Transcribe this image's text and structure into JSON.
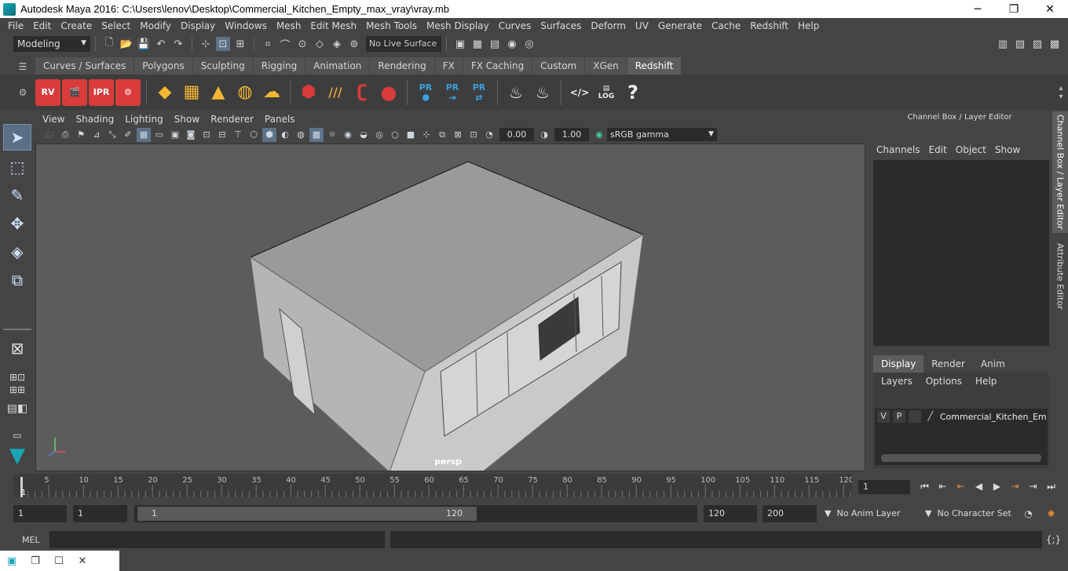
{
  "window": {
    "title": "Autodesk Maya 2016: C:\\Users\\lenov\\Desktop\\Commercial_Kitchen_Empty_max_vray\\vray.mb",
    "minimize": "─",
    "maximize": "❐",
    "close": "✕"
  },
  "menubar": [
    "File",
    "Edit",
    "Create",
    "Select",
    "Modify",
    "Display",
    "Windows",
    "Mesh",
    "Edit Mesh",
    "Mesh Tools",
    "Mesh Display",
    "Curves",
    "Surfaces",
    "Deform",
    "UV",
    "Generate",
    "Cache",
    "Redshift",
    "Help"
  ],
  "statusline": {
    "mode": "Modeling",
    "live_surface": "No Live Surface"
  },
  "shelf_tabs": [
    "Curves / Surfaces",
    "Polygons",
    "Sculpting",
    "Rigging",
    "Animation",
    "Rendering",
    "FX",
    "FX Caching",
    "Custom",
    "XGen",
    "Redshift"
  ],
  "shelf_active_tab": "Redshift",
  "shelf_labels": {
    "rv": "RV",
    "ipr": "IPR",
    "pr1": "PR",
    "pr2": "PR",
    "pr3": "PR",
    "log": "LOG",
    "help": "?"
  },
  "panel_menu": [
    "View",
    "Shading",
    "Lighting",
    "Show",
    "Renderer",
    "Panels"
  ],
  "panel_tools": {
    "exposure": "0.00",
    "gamma_value": "1.00",
    "color_mgmt": "sRGB gamma"
  },
  "viewport": {
    "camera": "persp"
  },
  "channel_box": {
    "title": "Channel Box / Layer Editor",
    "menu": [
      "Channels",
      "Edit",
      "Object",
      "Show"
    ]
  },
  "layer_editor": {
    "tabs": [
      "Display",
      "Render",
      "Anim"
    ],
    "active_tab": "Display",
    "menu": [
      "Layers",
      "Options",
      "Help"
    ],
    "layers": [
      {
        "v": "V",
        "p": "P",
        "name": "Commercial_Kitchen_Empty"
      }
    ]
  },
  "side_tabs": [
    "Channel Box / Layer Editor",
    "Attribute Editor"
  ],
  "timeline": {
    "ticks": [
      5,
      10,
      15,
      20,
      25,
      30,
      35,
      40,
      45,
      50,
      55,
      60,
      65,
      70,
      75,
      80,
      85,
      90,
      95,
      100,
      105,
      110,
      115,
      120
    ],
    "current": "1",
    "current_frame_field": "1"
  },
  "range": {
    "start": "1",
    "anim_start": "1",
    "slider_start": "1",
    "slider_end": "120",
    "end": "120",
    "anim_end": "200",
    "anim_layer": "No Anim Layer",
    "char_set": "No Character Set"
  },
  "cmdline": {
    "label": "MEL"
  }
}
